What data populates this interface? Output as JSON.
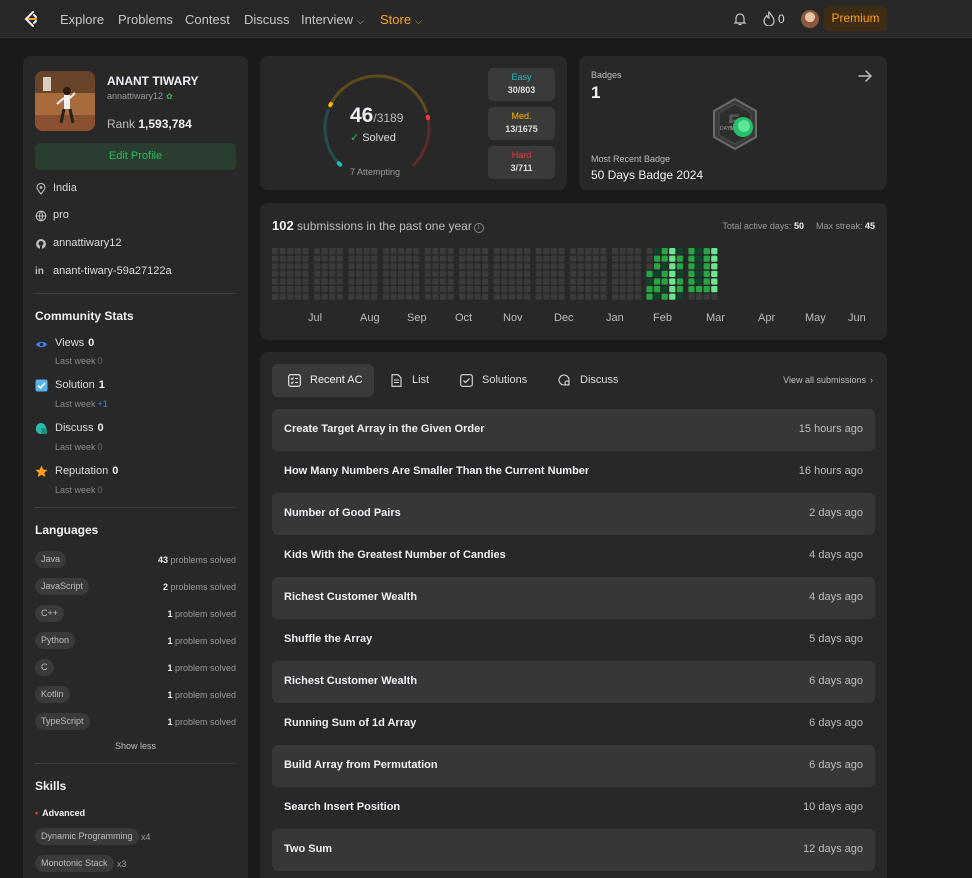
{
  "nav": {
    "items": [
      "Explore",
      "Problems",
      "Contest",
      "Discuss",
      "Interview",
      "Store"
    ],
    "interview_chevron": "chevron-down-icon",
    "store_chevron": "chevron-down-icon",
    "streak": "0",
    "premium": "Premium"
  },
  "profile": {
    "name": "ANANT TIWARY",
    "handle": "annattiwary12",
    "rank_label": "Rank",
    "rank": "1,593,784",
    "edit_button": "Edit Profile",
    "location": "India",
    "website": "pro",
    "github": "annattiwary12",
    "linkedin": "anant-tiwary-59a27122a"
  },
  "community": {
    "title": "Community Stats",
    "stats": [
      {
        "label": "Views",
        "value": "0",
        "sub": "Last week",
        "delta": "0",
        "positive": false
      },
      {
        "label": "Solution",
        "value": "1",
        "sub": "Last week",
        "delta": "+1",
        "positive": true
      },
      {
        "label": "Discuss",
        "value": "0",
        "sub": "Last week",
        "delta": "0",
        "positive": false
      },
      {
        "label": "Reputation",
        "value": "0",
        "sub": "Last week",
        "delta": "0",
        "positive": false
      }
    ]
  },
  "languages": {
    "title": "Languages",
    "items": [
      {
        "name": "Java",
        "count": "43",
        "unit": "problems solved"
      },
      {
        "name": "JavaScript",
        "count": "2",
        "unit": "problems solved"
      },
      {
        "name": "C++",
        "count": "1",
        "unit": "problem solved"
      },
      {
        "name": "Python",
        "count": "1",
        "unit": "problem solved"
      },
      {
        "name": "C",
        "count": "1",
        "unit": "problem solved"
      },
      {
        "name": "Kotlin",
        "count": "1",
        "unit": "problem solved"
      },
      {
        "name": "TypeScript",
        "count": "1",
        "unit": "problem solved"
      }
    ],
    "show_less": "Show less"
  },
  "skills": {
    "title": "Skills",
    "level": "Advanced",
    "items": [
      {
        "name": "Dynamic Programming",
        "count": "x4"
      },
      {
        "name": "Monotonic Stack",
        "count": "x3"
      }
    ]
  },
  "solved": {
    "count": "46",
    "total": "/3189",
    "label": "Solved",
    "attempting": "7 Attempting",
    "easy": {
      "label": "Easy",
      "value": "30/803",
      "solved": 30,
      "total": 803
    },
    "medium": {
      "label": "Med.",
      "value": "13/1675",
      "solved": 13,
      "total": 1675
    },
    "hard": {
      "label": "Hard",
      "value": "3/711",
      "solved": 3,
      "total": 711
    },
    "colors": {
      "easy": "#1cbaba",
      "medium": "#ffb700",
      "hard": "#f63737"
    }
  },
  "badges": {
    "label": "Badges",
    "count": "1",
    "recent_label": "Most Recent Badge",
    "recent_name": "50 Days Badge 2024",
    "badge_text": "DAYS"
  },
  "heatmap": {
    "count": "102",
    "text": "submissions in the past one year",
    "total_active_label": "Total active days:",
    "total_active": "50",
    "max_streak_label": "Max streak:",
    "max_streak": "45",
    "months": [
      "Jul",
      "Aug",
      "Sep",
      "Oct",
      "Nov",
      "Dec",
      "Jan",
      "Feb",
      "Mar",
      "Apr",
      "May",
      "Jun"
    ],
    "colors": {
      "empty": "#3a3a3a",
      "low": "#0e4429",
      "mid": "#26a641",
      "high": "#6be68f"
    }
  },
  "recent": {
    "tabs": [
      "Recent AC",
      "List",
      "Solutions",
      "Discuss"
    ],
    "view_all": "View all submissions",
    "submissions": [
      {
        "title": "Create Target Array in the Given Order",
        "time": "15 hours ago"
      },
      {
        "title": "How Many Numbers Are Smaller Than the Current Number",
        "time": "16 hours ago"
      },
      {
        "title": "Number of Good Pairs",
        "time": "2 days ago"
      },
      {
        "title": "Kids With the Greatest Number of Candies",
        "time": "4 days ago"
      },
      {
        "title": "Richest Customer Wealth",
        "time": "4 days ago"
      },
      {
        "title": "Shuffle the Array",
        "time": "5 days ago"
      },
      {
        "title": "Richest Customer Wealth",
        "time": "6 days ago"
      },
      {
        "title": "Running Sum of 1d Array",
        "time": "6 days ago"
      },
      {
        "title": "Build Array from Permutation",
        "time": "6 days ago"
      },
      {
        "title": "Search Insert Position",
        "time": "10 days ago"
      },
      {
        "title": "Two Sum",
        "time": "12 days ago"
      }
    ]
  }
}
